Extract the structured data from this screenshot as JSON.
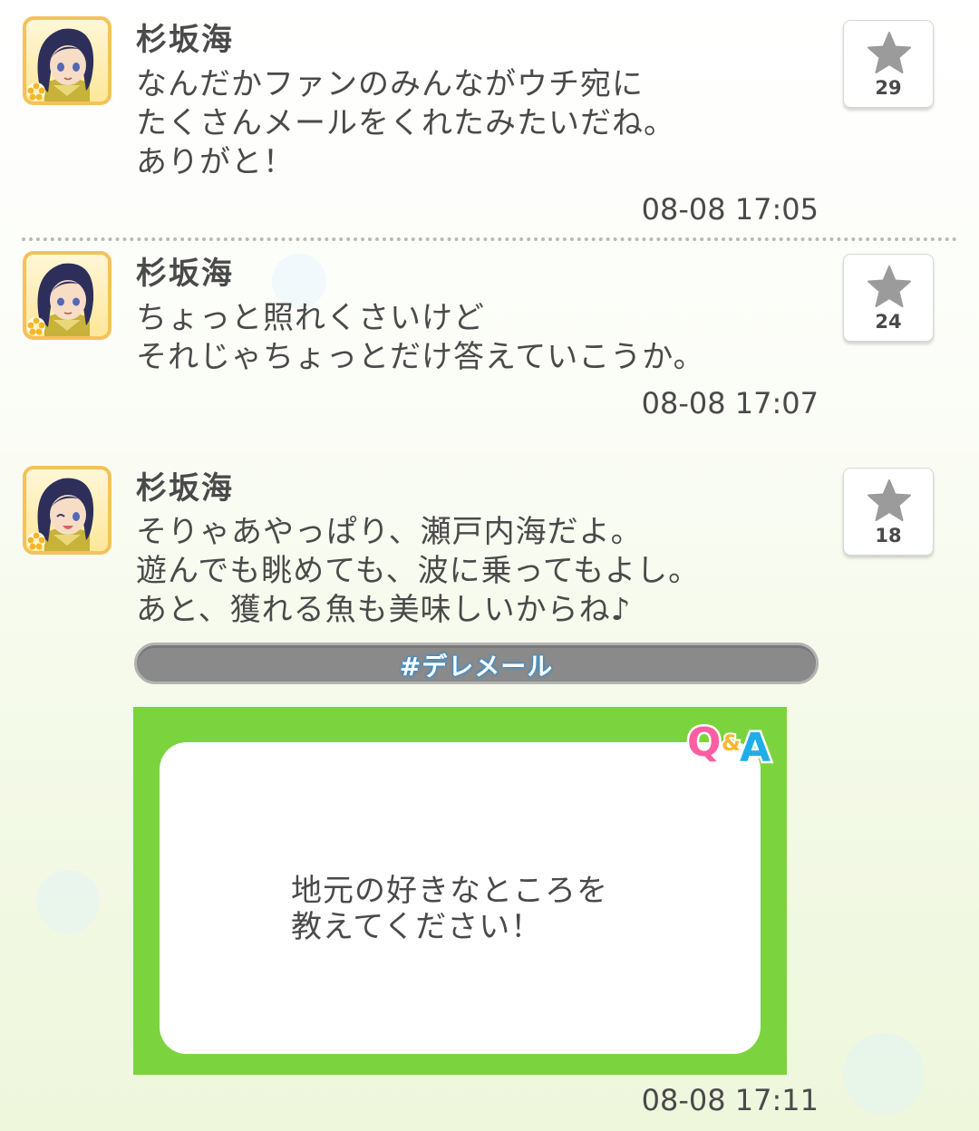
{
  "posts": [
    {
      "author": "杉坂海",
      "lines": [
        "なんだかファンのみんながウチ宛に",
        "たくさんメールをくれたみたいだね。",
        "ありがと！"
      ],
      "timestamp": "08-08 17:05",
      "likes": "29"
    },
    {
      "author": "杉坂海",
      "lines": [
        "ちょっと照れくさいけど",
        "それじゃちょっとだけ答えていこうか。"
      ],
      "timestamp": "08-08 17:07",
      "likes": "24"
    },
    {
      "author": "杉坂海",
      "lines": [
        "そりゃあやっぱり、瀬戸内海だよ。",
        "遊んでも眺めても、波に乗ってもよし。",
        "あと、獲れる魚も美味しいからね♪"
      ],
      "timestamp": "08-08 17:11",
      "likes": "18",
      "tag": "#デレメール",
      "qa": {
        "badge": "Q&A",
        "question_lines": [
          "地元の好きなところを",
          "教えてください！"
        ]
      }
    }
  ],
  "colors": {
    "avatar_border": "#f4c25a",
    "card_green": "#7bd43e",
    "tag_bar": "#8a8a8a",
    "text": "#4a4a4a"
  },
  "icons": {
    "like": "star-icon",
    "qa": "qa-badge-icon"
  }
}
